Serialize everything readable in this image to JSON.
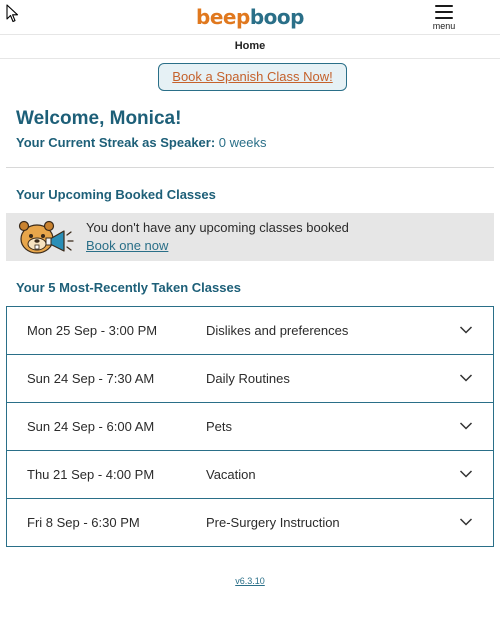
{
  "header": {
    "logo_part1": "beep",
    "logo_part2": "boop",
    "menu_label": "menu"
  },
  "breadcrumb": {
    "title": "Home"
  },
  "cta": {
    "label": "Book a Spanish Class Now!"
  },
  "welcome": {
    "title": "Welcome, Monica!"
  },
  "streak": {
    "label": "Your Current Streak as Speaker:",
    "value": "0 weeks"
  },
  "upcoming": {
    "heading": "Your Upcoming Booked Classes",
    "message": "You don't have any upcoming classes booked",
    "link": "Book one now",
    "mascot_icon": "megaphone-mascot-icon"
  },
  "recent": {
    "heading": "Your 5 Most-Recently Taken Classes",
    "classes": [
      {
        "date": "Mon 25 Sep - 3:00 PM",
        "topic": "Dislikes and preferences"
      },
      {
        "date": "Sun 24 Sep - 7:30 AM",
        "topic": "Daily Routines"
      },
      {
        "date": "Sun 24 Sep - 6:00 AM",
        "topic": "Pets"
      },
      {
        "date": "Thu 21 Sep - 4:00 PM",
        "topic": "Vacation"
      },
      {
        "date": "Fri 8 Sep - 6:30 PM",
        "topic": "Pre-Surgery Instruction"
      }
    ]
  },
  "footer": {
    "version": "v6.3.10"
  },
  "colors": {
    "brand_orange": "#e0781e",
    "brand_teal": "#2a6f88",
    "heading_teal": "#1d5f78",
    "cta_bg": "#e6f1f5",
    "box_gray": "#e6e6e6"
  }
}
